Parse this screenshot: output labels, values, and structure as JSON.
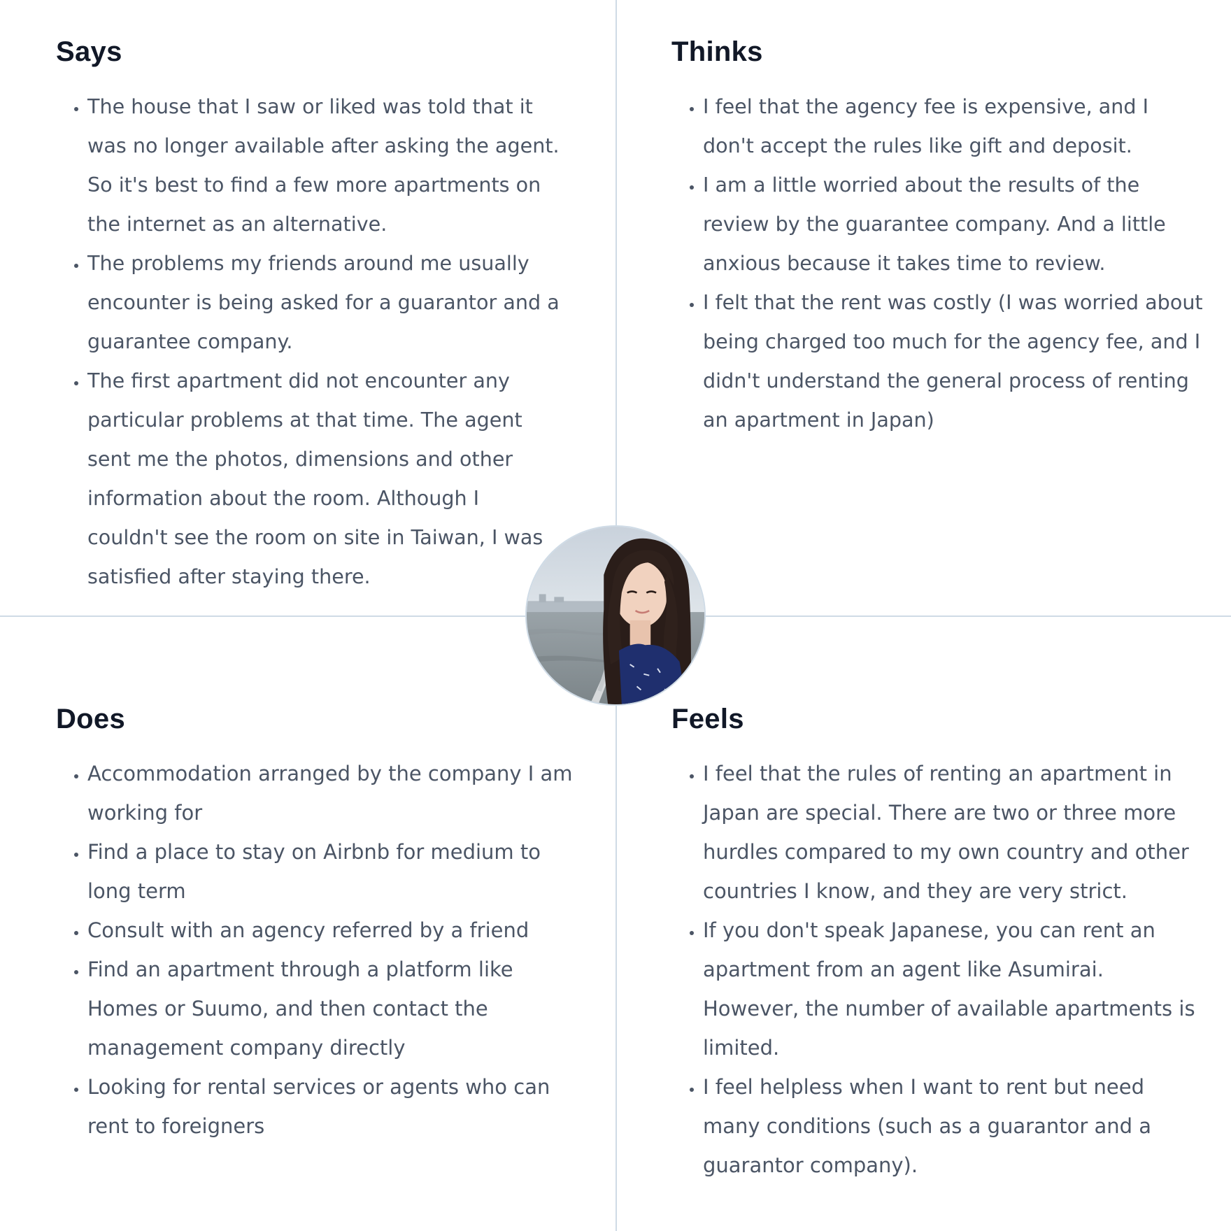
{
  "says": {
    "title": "Says",
    "items": [
      "The house that I saw or liked was told that it was no longer available after asking the agent. So it's best to find a few more apartments on the internet as an alternative.",
      "The problems my friends around me usually encounter is being asked for a guarantor and a guarantee company.",
      "The first apartment did not encounter any particular problems at that time. The agent sent me the photos, dimensions and other information about the room. Although I couldn't see the room on site in Taiwan, I was satisfied after staying there."
    ]
  },
  "thinks": {
    "title": "Thinks",
    "items": [
      "I feel that the agency fee is expensive, and I don't accept the rules like gift and deposit.",
      "I am a little worried about the results of the review by the guarantee company. And a little anxious because it takes time to review.",
      "I felt that the rent was costly (I was worried about being charged too much for the agency fee, and I didn't understand the general process of renting an apartment in Japan)"
    ]
  },
  "does": {
    "title": "Does",
    "items": [
      "Accommodation arranged by the company I am working for",
      "Find a place to stay on Airbnb for medium to long term",
      "Consult with an agency referred by a friend",
      "Find an apartment through a platform like Homes or Suumo, and then contact the management company directly",
      "Looking for rental services or agents who can rent to foreigners"
    ]
  },
  "feels": {
    "title": "Feels",
    "items": [
      "I feel that the rules of renting an apartment in Japan are special. There are two or three more hurdles compared to my own country and other countries I know, and they are very strict.",
      "If you don't speak Japanese, you can rent an apartment from an agent like Asumirai. However, the number of available apartments is limited.",
      "I feel helpless when I want to rent but need many conditions (such as a guarantor and a guarantor company)."
    ]
  },
  "colors": {
    "heading": "#111827",
    "body": "#4b5565",
    "divider": "#cfdbe6"
  },
  "avatar": {
    "icon": "persona-photo"
  }
}
